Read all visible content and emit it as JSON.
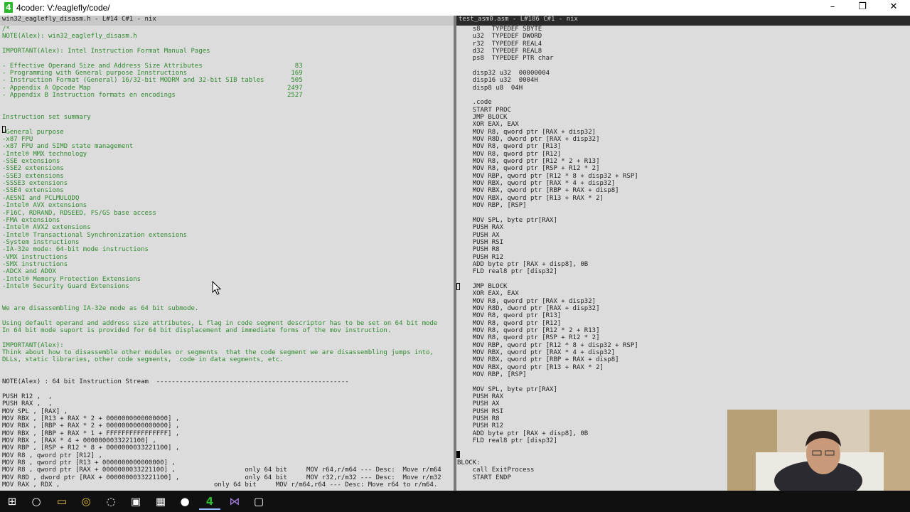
{
  "window": {
    "app_icon_label": "4",
    "title": "4coder: V:/eaglefly/code/",
    "min_glyph": "–",
    "max_glyph": "❐",
    "close_glyph": "✕"
  },
  "left_pane": {
    "header": "win32_eaglefly_disasm.h - L#14 C#1 - nix",
    "lines": [
      "/*",
      "NOTE(Alex): win32_eaglefly_disasm.h",
      "",
      "IMPORTANT(Alex): Intel Instruction Format Manual Pages",
      "",
      "- Effective Operand Size and Address Size Attributes                        83",
      "- Programming with General purpose Innstructions                           169",
      "- Instruction Format (General) 16/32-bit MODRM and 32-bit SIB tables       505",
      "- Appendix A Opcode Map                                                   2497",
      "- Appendix B Instruction formats en encodings                             2527",
      "",
      "",
      "Instruction set summary",
      "",
      "-General purpose",
      "-x87 FPU",
      "-x87 FPU and SIMD state management",
      "-Intel® MMX technology",
      "-SSE extensions",
      "-SSE2 extensions",
      "-SSE3 extensions",
      "-SSSE3 extensions",
      "-SSE4 extensions",
      "-AESNI and PCLMULQDQ",
      "-Intel® AVX extensions",
      "-F16C, RDRAND, RDSEED, FS/GS base access",
      "-FMA extensions",
      "-Intel® AVX2 extensions",
      "-Intel® Transactional Synchronization extensions",
      "-System instructions",
      "-IA-32e mode: 64-bit mode instructions",
      "-VMX instructions",
      "-SMX instructions",
      "-ADCX and ADOX",
      "-Intel® Memory Protection Extensions",
      "-Intel® Security Guard Extensions",
      "",
      "",
      "We are disassembling IA-32e mode as 64 bit submode.",
      "",
      "Using default operand and address size attributes, L flag in code segment descriptor has to be set on 64 bit mode",
      "In 64 bit mode suport is provided for 64 bit displacement and immediate forms of the mov instruction.",
      "",
      "IMPORTANT(Alex):",
      "Think about how to disassemble other modules or segments  that the code segment we are disassembling jumps into,",
      "DLLs, static libraries, other code segments,  code in data segments, etc.",
      "",
      "",
      "NOTE(Alex) : 64 bit Instruction Stream  --------------------------------------------------",
      "",
      "PUSH R12 ,  ,",
      "PUSH RAX ,  ,",
      "MOV SPL , [RAX] ,",
      "MOV RBX , [R13 + RAX * 2 + 0000000000000000] ,",
      "MOV RBX , [RBP + RAX * 2 + 0000000000000000] ,",
      "MOV RBX , [RBP + RAX * 1 + FFFFFFFFFFFFFFFF] ,",
      "MOV RBX , [RAX * 4 + 0000000033221100] ,",
      "MOV RBP , [RSP + R12 * 8 + 0000000033221100] ,",
      "MOV R8 , qword ptr [R12] ,",
      "MOV R8 , qword ptr [R13 + 0000000000000000] ,",
      "MOV R8 , qword ptr [RAX + 0000000033221100] ,                  only 64 bit     MOV r64,r/m64 --- Desc:  Move r/m64",
      "MOV R8D , dword ptr [RAX + 0000000033221100] ,                 only 64 bit     MOV r32,r/m32 --- Desc:  Move r/m32",
      "MOV RAX , RDX ,                                        only 64 bit     MOV r/m64,r64 --- Desc: Move r64 to r/m64."
    ]
  },
  "right_pane": {
    "header": "test_asm0.asm - L#186 C#1 - nix",
    "lines": [
      "    s8   TYPEDEF SBYTE",
      "    u32  TYPEDEF DWORD",
      "    r32  TYPEDEF REAL4",
      "    d32  TYPEDEF REAL8",
      "    ps8  TYPEDEF PTR char",
      "",
      "    disp32 u32  00000004",
      "    disp16 u32  0004H",
      "    disp8 u8  04H",
      "",
      "    .code",
      "    START PROC",
      "    JMP BLOCK",
      "    XOR EAX, EAX",
      "    MOV R8, qword ptr [RAX + disp32]",
      "    MOV R8D, dword ptr [RAX + disp32]",
      "    MOV R8, qword ptr [R13]",
      "    MOV R8, qword ptr [R12]",
      "    MOV R8, qword ptr [R12 * 2 + R13]",
      "    MOV R8, qword ptr [RSP + R12 * 2]",
      "    MOV RBP, qword ptr [R12 * 8 + disp32 + RSP]",
      "    MOV RBX, qword ptr [RAX * 4 + disp32]",
      "    MOV RBX, qword ptr [RBP + RAX + disp8]",
      "    MOV RBX, qword ptr [R13 + RAX * 2]",
      "    MOV RBP, [RSP]",
      "",
      "    MOV SPL, byte ptr[RAX]",
      "    PUSH RAX",
      "    PUSH AX",
      "    PUSH RSI",
      "    PUSH R8",
      "    PUSH R12",
      "    ADD byte ptr [RAX + disp8], 0B",
      "    FLD real8 ptr [disp32]",
      "",
      "    JMP BLOCK",
      "    XOR EAX, EAX",
      "    MOV R8, qword ptr [RAX + disp32]",
      "    MOV R8D, dword ptr [RAX + disp32]",
      "    MOV R8, qword ptr [R13]",
      "    MOV R8, qword ptr [R12]",
      "    MOV R8, qword ptr [R12 * 2 + R13]",
      "    MOV R8, qword ptr [RSP + R12 * 2]",
      "    MOV RBP, qword ptr [R12 * 8 + disp32 + RSP]",
      "    MOV RBX, qword ptr [RAX * 4 + disp32]",
      "    MOV RBX, qword ptr [RBP + RAX + disp8]",
      "    MOV RBX, qword ptr [R13 + RAX * 2]",
      "    MOV RBP, [RSP]",
      "",
      "    MOV SPL, byte ptr[RAX]",
      "    PUSH RAX",
      "    PUSH AX",
      "    PUSH RSI",
      "    PUSH R8",
      "    PUSH R12",
      "    ADD byte ptr [RAX + disp8], 0B",
      "    FLD real8 ptr [disp32]",
      "",
      "",
      "BLOCK:",
      "    call ExitProcess",
      "    START ENDP"
    ]
  },
  "taskbar": {
    "items": [
      {
        "name": "start-icon",
        "glyph": "⊞"
      },
      {
        "name": "cortana-search-icon",
        "glyph": "○"
      },
      {
        "name": "file-explorer-icon",
        "glyph": "▭"
      },
      {
        "name": "chrome-icon",
        "glyph": "◎"
      },
      {
        "name": "github-desktop-icon",
        "glyph": "◌"
      },
      {
        "name": "command-prompt-icon",
        "glyph": "▣"
      },
      {
        "name": "calculator-icon",
        "glyph": "▦"
      },
      {
        "name": "media-app-icon",
        "glyph": "●"
      },
      {
        "name": "4coder-taskbar-icon",
        "glyph": "4"
      },
      {
        "name": "visual-studio-icon",
        "glyph": "⋈"
      },
      {
        "name": "window-app-icon",
        "glyph": "▢"
      }
    ]
  },
  "colors": {
    "editor_bg": "#dcdcdc",
    "comment_green": "#2f8a2f",
    "code_text": "#1f1f1f",
    "taskbar_bg": "#101010",
    "app_icon_green": "#2db92d"
  }
}
